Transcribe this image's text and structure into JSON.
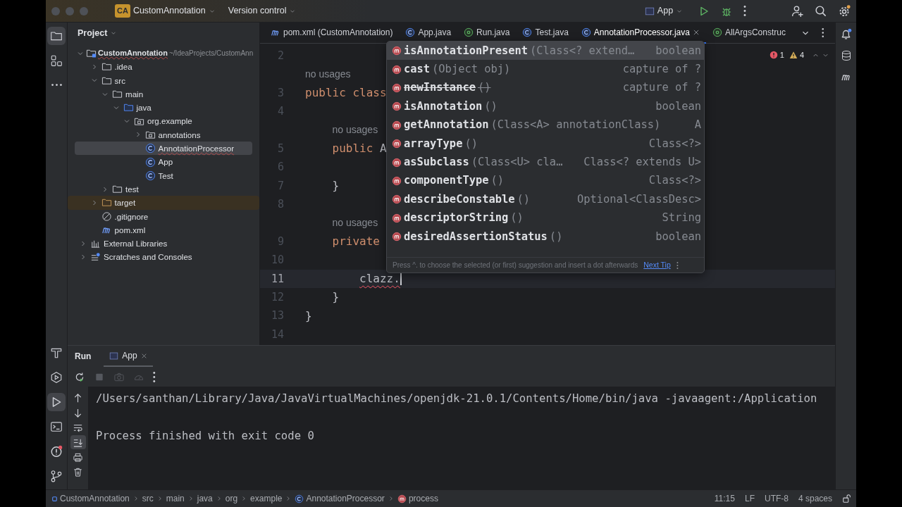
{
  "title_bar": {
    "badge": "CA",
    "project": "CustomAnnotation",
    "vcs": "Version control",
    "run_config": "App"
  },
  "left_strip": {
    "top": [
      {
        "kind": "project",
        "selected": true
      },
      {
        "kind": "structure",
        "selected": false
      },
      {
        "kind": "more",
        "selected": false
      }
    ],
    "bottom": [
      {
        "kind": "build",
        "selected": false
      },
      {
        "kind": "services",
        "selected": false
      },
      {
        "kind": "run",
        "selected": true
      },
      {
        "kind": "terminal",
        "selected": false
      },
      {
        "kind": "problems",
        "selected": false
      },
      {
        "kind": "git",
        "selected": false
      }
    ]
  },
  "project_panel": {
    "title": "Project",
    "tree": [
      {
        "label": "CustomAnnotation",
        "path": "~/IdeaProjects/CustomAnn",
        "kind": "module",
        "expanded": true,
        "selected": false,
        "errors": true,
        "children": [
          {
            "label": ".idea",
            "kind": "folder",
            "expanded": false,
            "selected": false
          },
          {
            "label": "src",
            "kind": "folder",
            "expanded": true,
            "selected": false,
            "children": [
              {
                "label": "main",
                "kind": "folder",
                "expanded": true,
                "selected": false,
                "children": [
                  {
                    "label": "java",
                    "kind": "source-folder",
                    "expanded": true,
                    "selected": false,
                    "children": [
                      {
                        "label": "org.example",
                        "kind": "package",
                        "expanded": true,
                        "selected": false,
                        "children": [
                          {
                            "label": "annotations",
                            "kind": "package",
                            "expanded": false,
                            "selected": false
                          },
                          {
                            "label": "AnnotationProcessor",
                            "kind": "class",
                            "selected": true,
                            "errors": true
                          },
                          {
                            "label": "App",
                            "kind": "class",
                            "selected": false
                          },
                          {
                            "label": "Test",
                            "kind": "class",
                            "selected": false
                          }
                        ]
                      }
                    ]
                  }
                ]
              },
              {
                "label": "test",
                "kind": "folder",
                "expanded": false,
                "selected": false
              }
            ]
          },
          {
            "label": "target",
            "kind": "excluded-folder",
            "expanded": false,
            "selected": false
          },
          {
            "label": ".gitignore",
            "kind": "ignore-file",
            "selected": false
          },
          {
            "label": "pom.xml",
            "kind": "maven",
            "selected": false
          }
        ]
      },
      {
        "label": "External Libraries",
        "kind": "library",
        "expanded": false,
        "selected": false
      },
      {
        "label": "Scratches and Consoles",
        "kind": "scratches",
        "expanded": false,
        "selected": false
      }
    ]
  },
  "editor": {
    "tabs": [
      {
        "label": "pom.xml (CustomAnnotation)",
        "kind": "maven",
        "selected": false
      },
      {
        "label": "App.java",
        "kind": "class",
        "selected": false
      },
      {
        "label": "Run.java",
        "kind": "annotation",
        "selected": false
      },
      {
        "label": "Test.java",
        "kind": "class",
        "selected": false
      },
      {
        "label": "AnnotationProcessor.java",
        "kind": "class",
        "selected": true,
        "closable": true
      },
      {
        "label": "AllArgsConstruc",
        "kind": "annotation",
        "selected": false
      }
    ],
    "problems": {
      "errors": "1",
      "warnings": "4"
    },
    "lines": [
      {
        "kind": "code",
        "number": "2",
        "current": false
      },
      {
        "kind": "inlay",
        "text": "no usages",
        "indented": false
      },
      {
        "kind": "code",
        "number": "3",
        "current": false,
        "tokens": [
          {
            "text": "public class",
            "kind": "keyword"
          }
        ]
      },
      {
        "kind": "code",
        "number": "4",
        "current": false
      },
      {
        "kind": "inlay",
        "text": "no usages",
        "indented": true
      },
      {
        "kind": "code",
        "number": "5",
        "current": false,
        "tokens": [
          {
            "text": "    public",
            "kind": "keyword"
          },
          {
            "text": " A",
            "kind": "plain"
          }
        ]
      },
      {
        "kind": "code",
        "number": "6",
        "current": false
      },
      {
        "kind": "code",
        "number": "7",
        "current": false,
        "tokens": [
          {
            "text": "    }",
            "kind": "plain"
          }
        ]
      },
      {
        "kind": "code",
        "number": "8",
        "current": false
      },
      {
        "kind": "inlay",
        "text": "no usages",
        "indented": true
      },
      {
        "kind": "code",
        "number": "9",
        "current": false,
        "tokens": [
          {
            "text": "    private",
            "kind": "keyword"
          }
        ]
      },
      {
        "kind": "code",
        "number": "10",
        "current": false
      },
      {
        "kind": "code",
        "number": "11",
        "current": true,
        "tokens": [
          {
            "text": "        clazz.",
            "kind": "error"
          }
        ]
      },
      {
        "kind": "code",
        "number": "12",
        "current": false,
        "tokens": [
          {
            "text": "    }",
            "kind": "plain"
          }
        ]
      },
      {
        "kind": "code",
        "number": "13",
        "current": false,
        "tokens": [
          {
            "text": "}",
            "kind": "plain"
          }
        ]
      },
      {
        "kind": "code",
        "number": "14",
        "current": false
      }
    ],
    "completion": {
      "items": [
        {
          "name": "isAnnotationPresent",
          "params": "(Class<? extend…",
          "type": "boolean",
          "selected": true,
          "deprecated": false
        },
        {
          "name": "cast",
          "params": "(Object obj)",
          "type": "capture of ?",
          "selected": false,
          "deprecated": false
        },
        {
          "name": "newInstance",
          "params": "()",
          "type": "capture of ?",
          "selected": false,
          "deprecated": true
        },
        {
          "name": "isAnnotation",
          "params": "()",
          "type": "boolean",
          "selected": false,
          "deprecated": false
        },
        {
          "name": "getAnnotation",
          "params": "(Class<A> annotationClass)",
          "type": "A",
          "selected": false,
          "deprecated": false
        },
        {
          "name": "arrayType",
          "params": "()",
          "type": "Class<?>",
          "selected": false,
          "deprecated": false
        },
        {
          "name": "asSubclass",
          "params": "(Class<U> cla…",
          "type": "Class<? extends U>",
          "selected": false,
          "deprecated": false
        },
        {
          "name": "componentType",
          "params": "()",
          "type": "Class<?>",
          "selected": false,
          "deprecated": false
        },
        {
          "name": "describeConstable",
          "params": "()",
          "type": "Optional<ClassDesc>",
          "selected": false,
          "deprecated": false
        },
        {
          "name": "descriptorString",
          "params": "()",
          "type": "String",
          "selected": false,
          "deprecated": false
        },
        {
          "name": "desiredAssertionStatus",
          "params": "()",
          "type": "boolean",
          "selected": false,
          "deprecated": false
        }
      ],
      "hint": "Press ^. to choose the selected (or first) suggestion and insert a dot afterwards",
      "next_tip": "Next Tip"
    }
  },
  "run_panel": {
    "title": "Run",
    "tabs": [
      {
        "label": "App",
        "selected": true,
        "closable": true
      }
    ],
    "toolbar": [
      {
        "kind": "rerun",
        "disabled": false
      },
      {
        "kind": "stop",
        "disabled": true
      },
      {
        "kind": "camera",
        "disabled": true
      },
      {
        "kind": "gauge",
        "disabled": true
      },
      {
        "kind": "more",
        "disabled": false
      }
    ],
    "side": [
      {
        "kind": "up",
        "selected": false
      },
      {
        "kind": "down",
        "selected": false
      },
      {
        "kind": "wrap",
        "selected": false
      },
      {
        "kind": "scroll-end",
        "selected": true
      },
      {
        "kind": "print",
        "selected": false
      },
      {
        "kind": "trash",
        "selected": false
      }
    ],
    "output": [
      {
        "text": "/Users/santhan/Library/Java/JavaVirtualMachines/openjdk-21.0.1/Contents/Home/bin/java -javaagent:/Application",
        "kind": "command"
      },
      {
        "text": "Process finished with exit code 0",
        "kind": "status"
      }
    ]
  },
  "status_bar": {
    "breadcrumbs": [
      {
        "label": "CustomAnnotation",
        "kind": "module"
      },
      {
        "label": "src",
        "kind": "plain"
      },
      {
        "label": "main",
        "kind": "plain"
      },
      {
        "label": "java",
        "kind": "plain"
      },
      {
        "label": "org",
        "kind": "plain"
      },
      {
        "label": "example",
        "kind": "plain"
      },
      {
        "label": "AnnotationProcessor",
        "kind": "class"
      },
      {
        "label": "process",
        "kind": "method"
      }
    ],
    "position": "11:15",
    "line_ending": "LF",
    "encoding": "UTF-8",
    "indent": "4 spaces"
  }
}
